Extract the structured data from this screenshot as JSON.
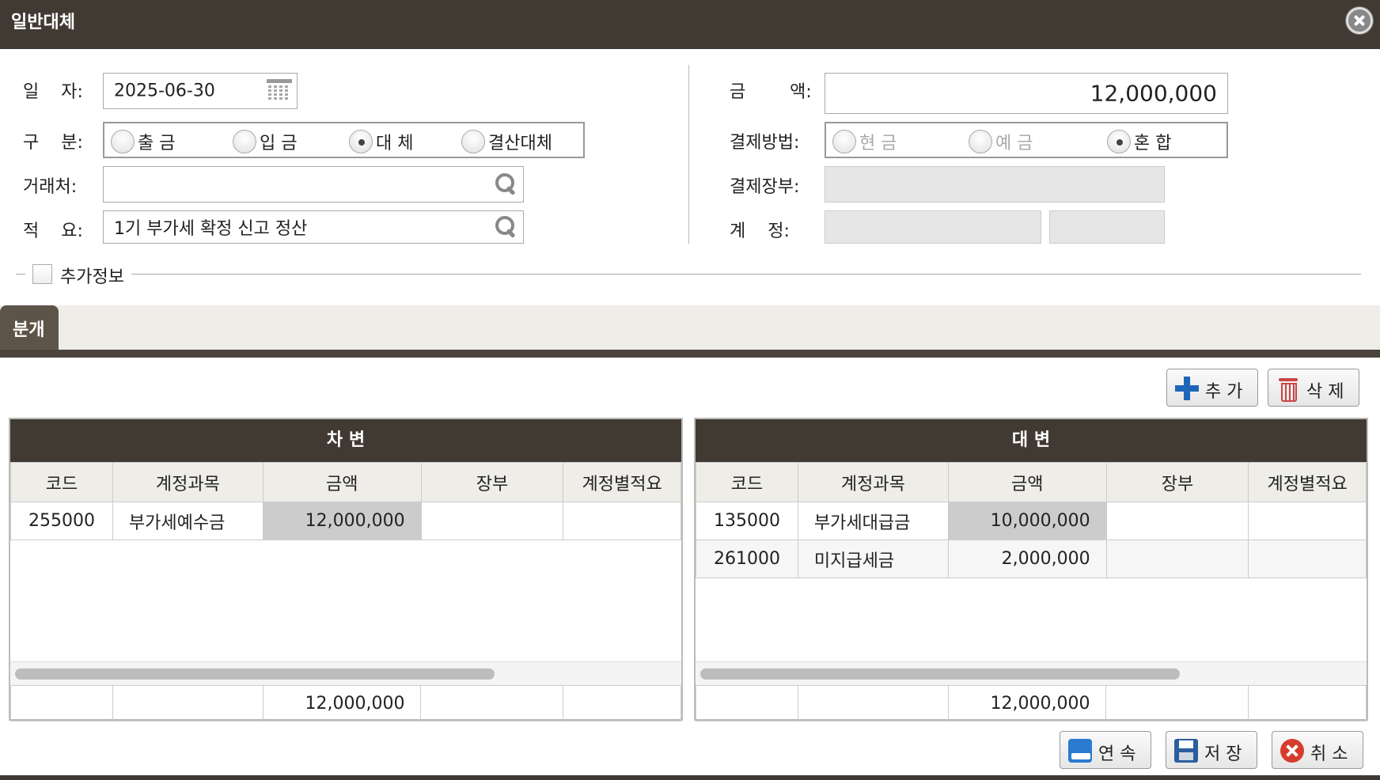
{
  "window": {
    "title": "일반대체"
  },
  "form": {
    "date_label": "일    자:",
    "date_value": "2025-06-30",
    "type_label": "구    분:",
    "type_options": [
      "출 금",
      "입 금",
      "대 체",
      "결산대체"
    ],
    "type_selected": "대 체",
    "partner_label": "거래처:",
    "partner_value": "",
    "memo_label": "적    요:",
    "memo_value": "1기 부가세 확정 신고 정산",
    "amount_label": "금        액:",
    "amount_value": "12,000,000",
    "payment_label": "결제방법:",
    "payment_options": [
      "현 금",
      "예 금",
      "혼 합"
    ],
    "payment_selected": "혼 합",
    "ledger_label": "결제장부:",
    "ledger_value": "",
    "account_label": "계    정:",
    "account_value_1": "",
    "account_value_2": "",
    "extra_label": "추가정보"
  },
  "tab": {
    "label": "분개"
  },
  "toolbar": {
    "add_label": "추 가",
    "delete_label": "삭 제"
  },
  "debit": {
    "title": "차 변",
    "columns": [
      "코드",
      "계정과목",
      "금액",
      "장부",
      "계정별적요"
    ],
    "rows": [
      {
        "code": "255000",
        "account": "부가세예수금",
        "amount": "12,000,000",
        "ledger": "",
        "memo": ""
      }
    ],
    "total": "12,000,000"
  },
  "credit": {
    "title": "대 변",
    "columns": [
      "코드",
      "계정과목",
      "금액",
      "장부",
      "계정별적요"
    ],
    "rows": [
      {
        "code": "135000",
        "account": "부가세대급금",
        "amount": "10,000,000",
        "ledger": "",
        "memo": ""
      },
      {
        "code": "261000",
        "account": "미지급세금",
        "amount": "2,000,000",
        "ledger": "",
        "memo": ""
      }
    ],
    "total": "12,000,000"
  },
  "footer": {
    "continue_label": "연 속",
    "save_label": "저 장",
    "cancel_label": "취 소"
  },
  "colors": {
    "header_bg": "#403a33",
    "tab_bg": "#5d5449",
    "highlight_cell": "#cccccc"
  }
}
